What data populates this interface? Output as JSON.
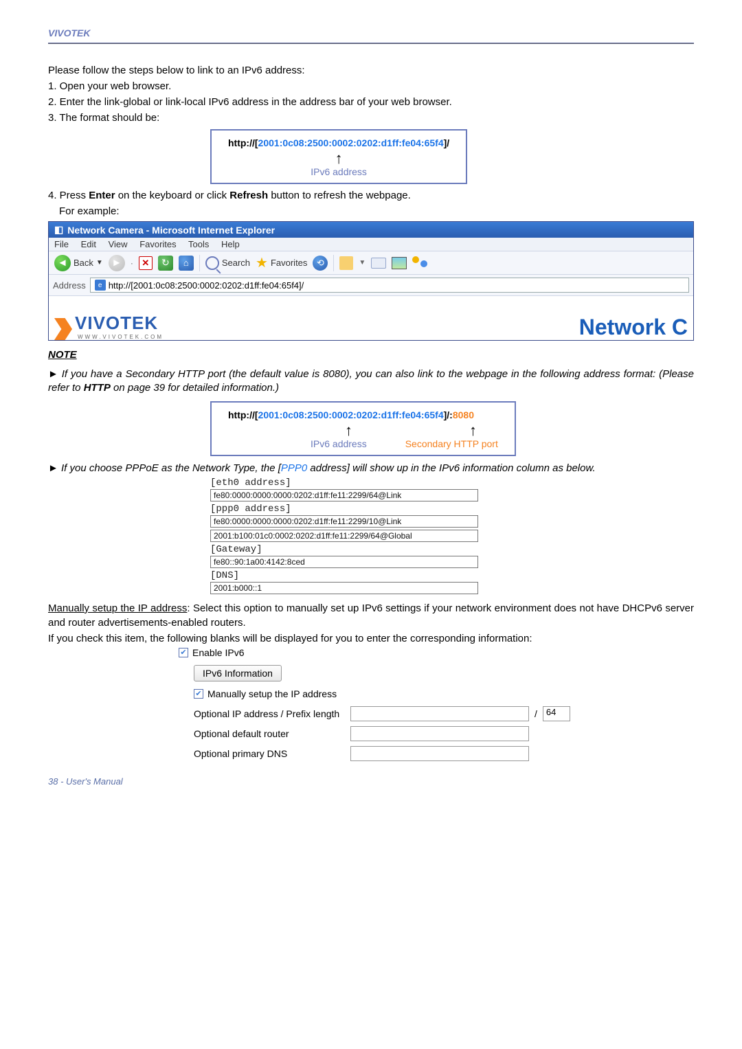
{
  "header": {
    "brand": "VIVOTEK"
  },
  "intro": {
    "l1": "Please follow the steps below to link to an IPv6 address:",
    "l2": "1. Open your web browser.",
    "l3": "2. Enter the link-global or link-local IPv6 address in the address bar of your web browser.",
    "l4": "3. The format should be:"
  },
  "format1": {
    "prefix": "http://",
    "lb": "[",
    "addr": "2001:0c08:2500:0002:0202:d1ff:fe04:65f4",
    "rb": "]",
    "suffix": "/",
    "label": "IPv6 address"
  },
  "step4a": "4. Press ",
  "step4b": "Enter",
  "step4c": " on the keyboard or click ",
  "step4d": "Refresh",
  "step4e": " button to refresh the webpage.",
  "step4f": "For example:",
  "ie": {
    "title": "Network Camera - Microsoft Internet Explorer",
    "menu": {
      "file": "File",
      "edit": "Edit",
      "view": "View",
      "fav": "Favorites",
      "tools": "Tools",
      "help": "Help"
    },
    "back": "Back",
    "search": "Search",
    "favorites": "Favorites",
    "addrlabel": "Address",
    "url": "http://[2001:0c08:2500:0002:0202:d1ff:fe04:65f4]/",
    "logotext": "VIVOTEK",
    "logosub": "WWW.VIVOTEK.COM",
    "heading": "Network C"
  },
  "note": {
    "head": "NOTE",
    "p1a": "► If you have a Secondary HTTP port (the default value is 8080), you can also link to the webpage in the following address format: (Please refer to ",
    "p1b": "HTTP",
    "p1c": " on page 39 for detailed information.)"
  },
  "format2": {
    "prefix": "http://",
    "lb": "[",
    "addr": "2001:0c08:2500:0002:0202:d1ff:fe04:65f4",
    "rb": "]",
    "suffix": "/:",
    "port": "8080",
    "label1": "IPv6 address",
    "label2": "Secondary HTTP port"
  },
  "note2a": "► If you choose PPPoE as the Network Type, the [",
  "note2b": "PPP0",
  "note2c": " address] will show up in the IPv6 information column as below.",
  "info": {
    "eth_h": "[eth0 address]",
    "eth_v": "fe80:0000:0000:0000:0202:d1ff:fe11:2299/64@Link",
    "ppp_h": "[ppp0 address]",
    "ppp_v1": "fe80:0000:0000:0000:0202:d1ff:fe11:2299/10@Link",
    "ppp_v2": "2001:b100:01c0:0002:0202:d1ff:fe11:2299/64@Global",
    "gw_h": "[Gateway]",
    "gw_v": "fe80::90:1a00:4142:8ced",
    "dns_h": "[DNS]",
    "dns_v": "2001:b000::1"
  },
  "manual": {
    "h": "Manually setup the IP address",
    "p": ": Select this option to manually set up IPv6 settings if your network environment does not have DHCPv6 server and router advertisements-enabled routers.",
    "p2": "If you check this item, the following blanks will be displayed for you to enter the corresponding information:",
    "enable": "Enable IPv6",
    "info_btn": "IPv6 Information",
    "chk2": "Manually setup the IP address",
    "row1": "Optional IP address / Prefix length",
    "slash": "/",
    "suffix": "64",
    "row2": "Optional default router",
    "row3": "Optional primary DNS"
  },
  "footer": "38 - User's Manual"
}
